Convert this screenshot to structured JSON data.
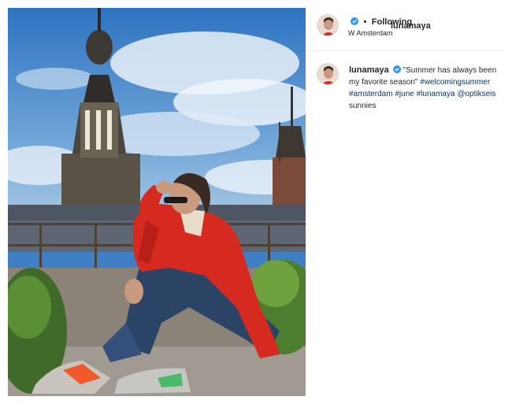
{
  "post": {
    "username": "lunamaya",
    "follow_status": "Following",
    "separator": "•",
    "location": "W Amsterdam"
  },
  "caption": {
    "username": "lunamaya",
    "text": "\"Summer has always been my favorite season\"",
    "hashtags": [
      "#welcomingsummer",
      "#amsterdam",
      "#june",
      "#lunamaya"
    ],
    "mention": "@optikseis",
    "trailing_text": "sunnies"
  },
  "colors": {
    "verified": "#3897f0",
    "link": "#00376b",
    "text": "#262626",
    "jacket": "#d62a20",
    "sky": "#3f7fc6"
  },
  "icons": {
    "verified": "verified-badge-icon"
  }
}
